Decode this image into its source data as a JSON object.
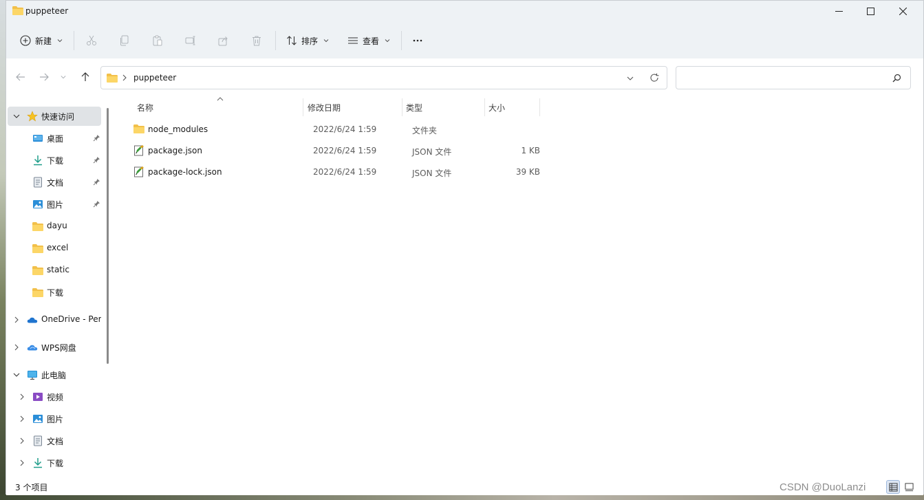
{
  "window": {
    "title": "puppeteer",
    "controls": {
      "minimize": "minimize-icon",
      "maximize": "maximize-icon",
      "close": "close-icon"
    }
  },
  "toolbar": {
    "new_label": "新建",
    "sort_label": "排序",
    "view_label": "查看",
    "more_label": "···",
    "icons": [
      "cut-icon",
      "copy-icon",
      "paste-icon",
      "rename-icon",
      "share-icon",
      "delete-icon"
    ]
  },
  "address": {
    "path": "puppeteer",
    "search_placeholder": ""
  },
  "sidebar": {
    "quick_access": "快速访问",
    "items": [
      {
        "label": "桌面",
        "icon": "desktop-icon",
        "pinned": true
      },
      {
        "label": "下载",
        "icon": "download-icon",
        "pinned": true
      },
      {
        "label": "文档",
        "icon": "document-icon",
        "pinned": true
      },
      {
        "label": "图片",
        "icon": "pictures-icon",
        "pinned": true
      },
      {
        "label": "dayu",
        "icon": "folder-icon",
        "pinned": false
      },
      {
        "label": "excel",
        "icon": "folder-icon",
        "pinned": false
      },
      {
        "label": "static",
        "icon": "folder-icon",
        "pinned": false
      },
      {
        "label": "下载",
        "icon": "folder-icon",
        "pinned": false
      }
    ],
    "onedrive": "OneDrive - Pers",
    "wps": "WPS网盘",
    "this_pc": "此电脑",
    "pc_items": [
      {
        "label": "视频",
        "icon": "videos-icon"
      },
      {
        "label": "图片",
        "icon": "pictures-icon"
      },
      {
        "label": "文档",
        "icon": "document-icon"
      },
      {
        "label": "下载",
        "icon": "download-icon"
      }
    ]
  },
  "columns": {
    "name": "名称",
    "date": "修改日期",
    "type": "类型",
    "size": "大小"
  },
  "files": [
    {
      "name": "node_modules",
      "date": "2022/6/24 1:59",
      "type": "文件夹",
      "size": "",
      "icon": "folder-icon"
    },
    {
      "name": "package.json",
      "date": "2022/6/24 1:59",
      "type": "JSON 文件",
      "size": "1 KB",
      "icon": "json-file-icon"
    },
    {
      "name": "package-lock.json",
      "date": "2022/6/24 1:59",
      "type": "JSON 文件",
      "size": "39 KB",
      "icon": "json-file-icon"
    }
  ],
  "status": {
    "item_count": "3 个项目"
  },
  "watermark": "CSDN @DuoLanzi"
}
